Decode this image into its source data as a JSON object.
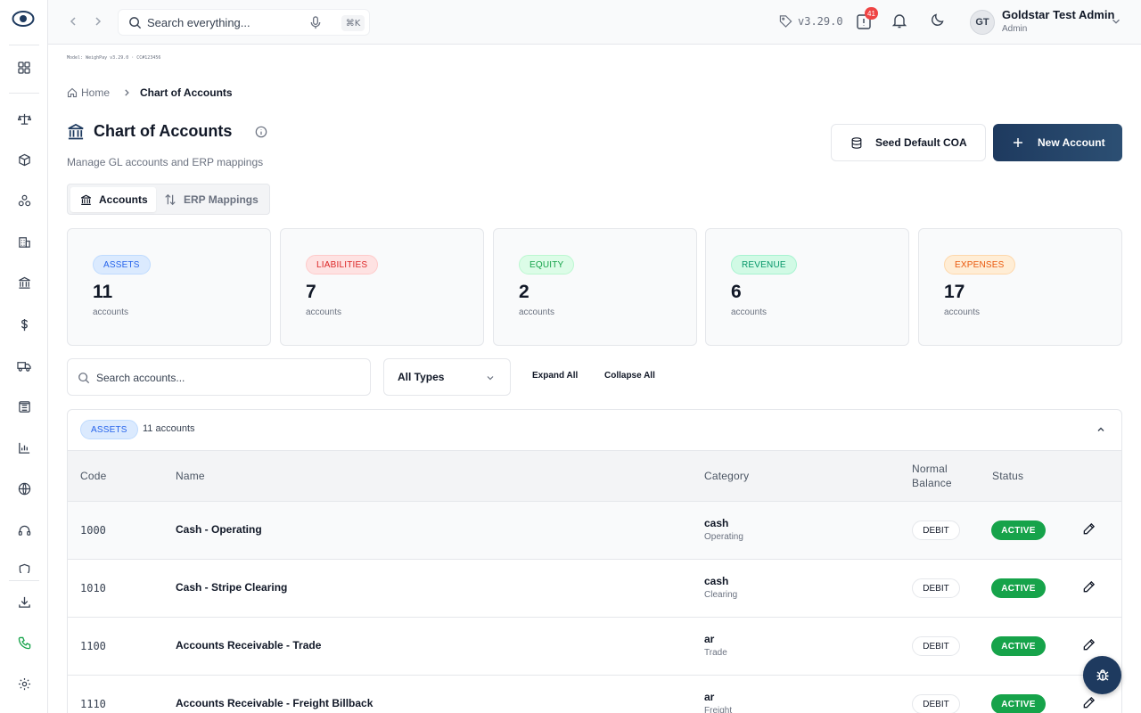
{
  "topbar": {
    "search_placeholder": "Search everything...",
    "shortcut": "⌘K",
    "version": "v3.29.0",
    "notification_count": "41",
    "user_initials": "GT",
    "user_name": "Goldstar Test Admin",
    "user_role": "Admin"
  },
  "sidebar": {
    "items": [
      {
        "icon": "dashboard-icon"
      },
      {
        "icon": "scale-icon"
      },
      {
        "icon": "box-icon"
      },
      {
        "icon": "components-icon"
      },
      {
        "icon": "buildings-icon"
      },
      {
        "icon": "bank-icon"
      },
      {
        "icon": "dollar-icon"
      },
      {
        "icon": "truck-icon"
      },
      {
        "icon": "ledger-icon"
      },
      {
        "icon": "bar-chart-icon"
      },
      {
        "icon": "globe-icon"
      },
      {
        "icon": "headset-icon"
      },
      {
        "icon": "shield-icon"
      },
      {
        "icon": "download-icon"
      },
      {
        "icon": "phone-icon"
      },
      {
        "icon": "settings-icon"
      }
    ]
  },
  "model_tag": "Model: WeighPay v3.29.0 · CC#123456",
  "breadcrumb": {
    "home": "Home",
    "current": "Chart of Accounts"
  },
  "page": {
    "title": "Chart of Accounts",
    "subtitle": "Manage GL accounts and ERP mappings",
    "seed_button": "Seed Default COA",
    "new_button": "New Account"
  },
  "tabs": [
    {
      "label": "Accounts",
      "active": true
    },
    {
      "label": "ERP Mappings",
      "active": false
    }
  ],
  "stats": [
    {
      "type": "ASSETS",
      "count": "11",
      "unit": "accounts",
      "color": "#2563eb"
    },
    {
      "type": "LIABILITIES",
      "count": "7",
      "unit": "accounts",
      "color": "#dc2626"
    },
    {
      "type": "EQUITY",
      "count": "2",
      "unit": "accounts",
      "color": "#16a34a"
    },
    {
      "type": "REVENUE",
      "count": "6",
      "unit": "accounts",
      "color": "#059669"
    },
    {
      "type": "EXPENSES",
      "count": "17",
      "unit": "accounts",
      "color": "#ea580c"
    }
  ],
  "filters": {
    "search_placeholder": "Search accounts...",
    "type_select": "All Types",
    "expand_all": "Expand All",
    "collapse_all": "Collapse All"
  },
  "group": {
    "type": "ASSETS",
    "count_label": "11 accounts",
    "columns": {
      "code": "Code",
      "name": "Name",
      "category": "Category",
      "normal_balance": "Normal Balance",
      "status": "Status"
    },
    "rows": [
      {
        "code": "1000",
        "name": "Cash - Operating",
        "category": "cash",
        "subcategory": "Operating",
        "normal_balance": "DEBIT",
        "status": "ACTIVE"
      },
      {
        "code": "1010",
        "name": "Cash - Stripe Clearing",
        "category": "cash",
        "subcategory": "Clearing",
        "normal_balance": "DEBIT",
        "status": "ACTIVE"
      },
      {
        "code": "1100",
        "name": "Accounts Receivable - Trade",
        "category": "ar",
        "subcategory": "Trade",
        "normal_balance": "DEBIT",
        "status": "ACTIVE"
      },
      {
        "code": "1110",
        "name": "Accounts Receivable - Freight Billback",
        "category": "ar",
        "subcategory": "Freight",
        "normal_balance": "DEBIT",
        "status": "ACTIVE"
      }
    ]
  },
  "colors": {
    "primary": "#1e3a5f",
    "active_status": "#16a34a",
    "badge": "#ef4444"
  }
}
